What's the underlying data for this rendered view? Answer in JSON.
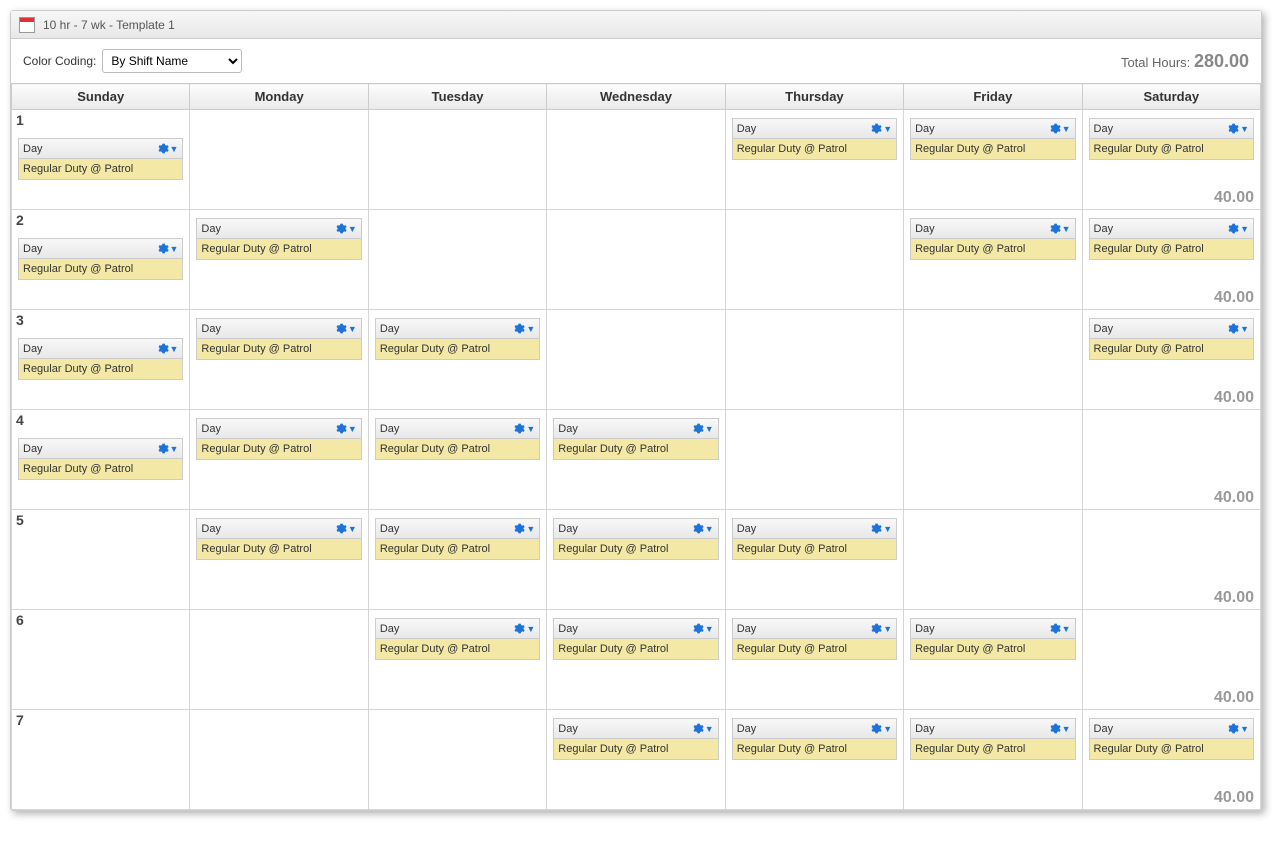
{
  "title": "10 hr - 7 wk - Template 1",
  "colorCodingLabel": "Color Coding:",
  "colorCodingValue": "By Shift Name",
  "totalHoursLabel": "Total Hours:",
  "totalHoursValue": "280.00",
  "days": [
    "Sunday",
    "Monday",
    "Tuesday",
    "Wednesday",
    "Thursday",
    "Friday",
    "Saturday"
  ],
  "shiftName": "Day",
  "shiftDetail": "Regular Duty @ Patrol",
  "rows": [
    {
      "num": "1",
      "hours": "40.00",
      "cells": [
        true,
        false,
        false,
        false,
        true,
        true,
        true
      ]
    },
    {
      "num": "2",
      "hours": "40.00",
      "cells": [
        true,
        true,
        false,
        false,
        false,
        true,
        true
      ]
    },
    {
      "num": "3",
      "hours": "40.00",
      "cells": [
        true,
        true,
        true,
        false,
        false,
        false,
        true
      ]
    },
    {
      "num": "4",
      "hours": "40.00",
      "cells": [
        true,
        true,
        true,
        true,
        false,
        false,
        false
      ]
    },
    {
      "num": "5",
      "hours": "40.00",
      "cells": [
        false,
        true,
        true,
        true,
        true,
        false,
        false
      ]
    },
    {
      "num": "6",
      "hours": "40.00",
      "cells": [
        false,
        false,
        true,
        true,
        true,
        true,
        false
      ]
    },
    {
      "num": "7",
      "hours": "40.00",
      "cells": [
        false,
        false,
        false,
        true,
        true,
        true,
        true
      ]
    }
  ]
}
